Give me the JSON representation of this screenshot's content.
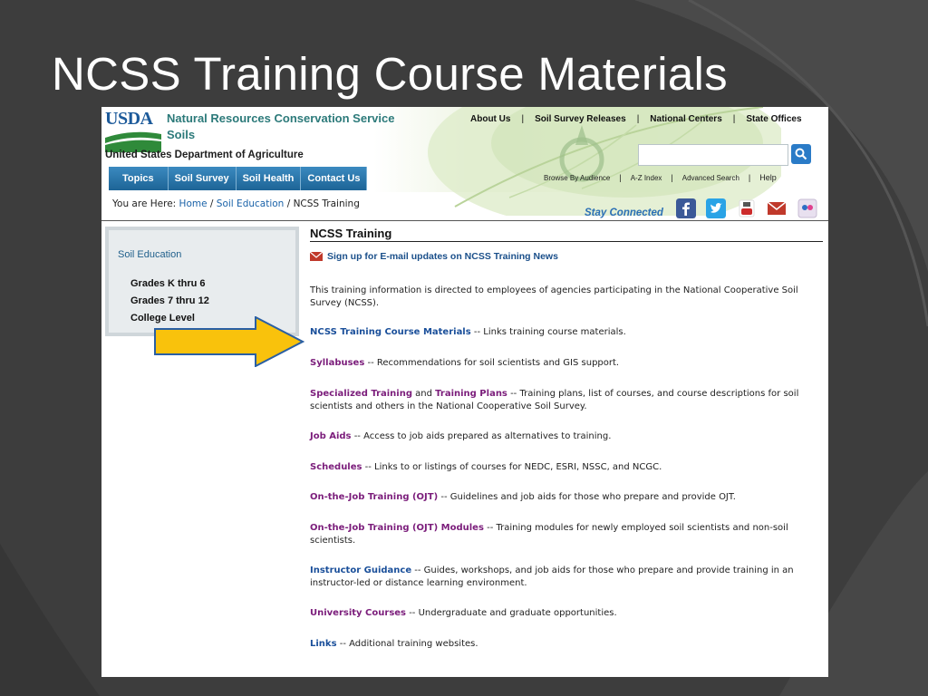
{
  "slide": {
    "title": "NCSS Training Course Materials"
  },
  "header": {
    "logo_text": "USDA",
    "agency_line1": "Natural Resources Conservation Service",
    "agency_line2": "Soils",
    "department": "United States Department of Agriculture",
    "top_links": [
      "About Us",
      "Soil Survey Releases",
      "National Centers",
      "State Offices"
    ],
    "top_link_separator": "|",
    "search": {
      "value": "",
      "placeholder": ""
    },
    "nav_tabs": [
      "Topics",
      "Soil Survey",
      "Soil Health",
      "Contact Us"
    ],
    "utility_links": [
      "Browse By Audience",
      "A-Z Index",
      "Advanced Search",
      "Help"
    ]
  },
  "breadcrumb": {
    "prefix": "You are Here:",
    "home": "Home",
    "section": "Soil Education",
    "current": "NCSS Training",
    "sep": "/"
  },
  "social": {
    "label": "Stay Connected",
    "icons": [
      "facebook-icon",
      "twitter-icon",
      "youtube-icon",
      "email-icon",
      "flickr-icon"
    ],
    "colors": {
      "facebook": "#3b5998",
      "twitter": "#2aa3e6",
      "youtube": "#cc2b2b",
      "email": "#c0392b",
      "flickr": "#e8e0ef"
    }
  },
  "sidebar": {
    "title": "Soil Education",
    "items": [
      "Grades K thru 6",
      "Grades 7 thru 12",
      "College Level"
    ]
  },
  "callout_arrow": {
    "color": "#f9c20c"
  },
  "main": {
    "title": "NCSS Training",
    "signup": "Sign up for E-mail updates on NCSS Training News",
    "intro": "This training information is directed to employees of agencies participating in the National Cooperative Soil Survey (NCSS).",
    "entries": [
      {
        "link": "NCSS Training Course Materials",
        "text": " -- Links training course materials."
      },
      {
        "link": "Syllabuses",
        "text": " -- Recommendations for soil scientists and GIS support."
      },
      {
        "link": "Specialized Training",
        "mid": " and ",
        "link2": "Training Plans",
        "text": " -- Training plans, list of courses, and course descriptions for soil scientists and others in the National Cooperative Soil Survey."
      },
      {
        "link": "Job Aids",
        "text": " -- Access to job aids prepared as alternatives to training."
      },
      {
        "link": "Schedules",
        "text": " -- Links to or listings of courses for NEDC, ESRI, NSSC, and NCGC."
      },
      {
        "link": "On-the-Job Training (OJT)",
        "text": " -- Guidelines and job aids for those who prepare and provide OJT."
      },
      {
        "link": "On-the-Job Training (OJT) Modules",
        "text": " -- Training modules for newly employed soil scientists and non-soil scientists."
      },
      {
        "link": "Instructor Guidance",
        "text": " -- Guides, workshops, and job aids for those who prepare and provide training in an instructor-led or distance learning environment."
      },
      {
        "link": "University Courses",
        "text": " -- Undergraduate and graduate opportunities."
      },
      {
        "link": "Links",
        "text": " -- Additional training websites."
      }
    ]
  }
}
